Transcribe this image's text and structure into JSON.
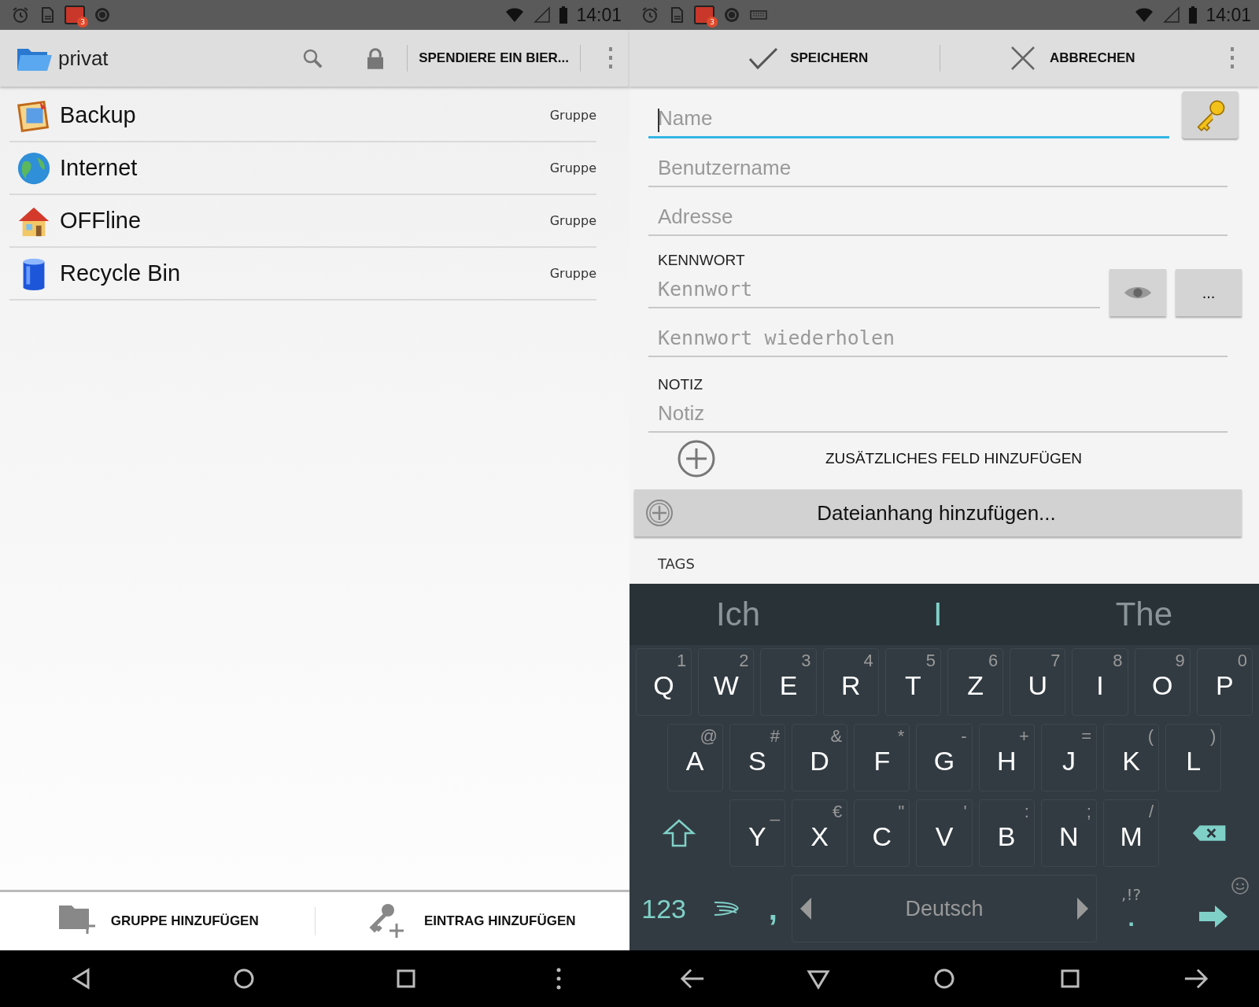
{
  "left": {
    "status": {
      "badge": "3",
      "time": "14:01"
    },
    "toolbar": {
      "title": "privat",
      "donate": "SPENDIERE EIN BIER..."
    },
    "groups": [
      {
        "name": "Backup",
        "type": "Gruppe"
      },
      {
        "name": "Internet",
        "type": "Gruppe"
      },
      {
        "name": "OFFline",
        "type": "Gruppe"
      },
      {
        "name": "Recycle Bin",
        "type": "Gruppe"
      }
    ],
    "bottom_actions": [
      {
        "label": "GRUPPE HINZUFÜGEN",
        "kind": "group"
      },
      {
        "label": "EINTRAG HINZUFÜGEN",
        "kind": "entry"
      }
    ]
  },
  "right": {
    "status": {
      "badge": "3",
      "time": "14:01"
    },
    "actions": [
      {
        "label": "SPEICHERN",
        "kind": "save"
      },
      {
        "label": "ABBRECHEN",
        "kind": "cancel"
      }
    ],
    "fields": [
      {
        "kind": "name",
        "placeholder": "Name",
        "focused": true
      },
      {
        "kind": "text",
        "placeholder": "Benutzername",
        "focused": false
      },
      {
        "kind": "text",
        "placeholder": "Adresse",
        "focused": false
      },
      {
        "kind": "password",
        "label": "KENNWORT",
        "placeholder": "Kennwort",
        "focused": false,
        "more": "..."
      },
      {
        "kind": "repeat",
        "placeholder": "Kennwort wiederholen",
        "focused": false
      },
      {
        "kind": "note",
        "label": "NOTIZ",
        "placeholder": "Notiz",
        "focused": false
      }
    ],
    "add_field": "ZUSÄTZLICHES FELD HINZUFÜGEN",
    "attachment": "Dateianhang hinzufügen...",
    "tags_label": "TAGS",
    "keyboard": {
      "suggestions": [
        {
          "text": "Ich",
          "selected": false
        },
        {
          "text": "I",
          "selected": true
        },
        {
          "text": "The",
          "selected": false
        }
      ],
      "rows": [
        {
          "keys": [
            {
              "kind": "char",
              "label": "Q",
              "hint": "1"
            },
            {
              "kind": "char",
              "label": "W",
              "hint": "2"
            },
            {
              "kind": "char",
              "label": "E",
              "hint": "3"
            },
            {
              "kind": "char",
              "label": "R",
              "hint": "4"
            },
            {
              "kind": "char",
              "label": "T",
              "hint": "5"
            },
            {
              "kind": "char",
              "label": "Z",
              "hint": "6"
            },
            {
              "kind": "char",
              "label": "U",
              "hint": "7"
            },
            {
              "kind": "char",
              "label": "I",
              "hint": "8"
            },
            {
              "kind": "char",
              "label": "O",
              "hint": "9"
            },
            {
              "kind": "char",
              "label": "P",
              "hint": "0"
            }
          ]
        },
        {
          "keys": [
            {
              "kind": "char",
              "label": "A",
              "hint": "@"
            },
            {
              "kind": "char",
              "label": "S",
              "hint": "#"
            },
            {
              "kind": "char",
              "label": "D",
              "hint": "&"
            },
            {
              "kind": "char",
              "label": "F",
              "hint": "*"
            },
            {
              "kind": "char",
              "label": "G",
              "hint": "-"
            },
            {
              "kind": "char",
              "label": "H",
              "hint": "+"
            },
            {
              "kind": "char",
              "label": "J",
              "hint": "="
            },
            {
              "kind": "char",
              "label": "K",
              "hint": "("
            },
            {
              "kind": "char",
              "label": "L",
              "hint": ")"
            }
          ]
        },
        {
          "keys": [
            {
              "kind": "shift"
            },
            {
              "kind": "char",
              "label": "Y",
              "hint": "_"
            },
            {
              "kind": "char",
              "label": "X",
              "hint": "€"
            },
            {
              "kind": "char",
              "label": "C",
              "hint": "\""
            },
            {
              "kind": "char",
              "label": "V",
              "hint": "'"
            },
            {
              "kind": "char",
              "label": "B",
              "hint": ":"
            },
            {
              "kind": "char",
              "label": "N",
              "hint": ";"
            },
            {
              "kind": "char",
              "label": "M",
              "hint": "/"
            },
            {
              "kind": "backspace"
            }
          ]
        },
        {
          "keys": [
            {
              "kind": "num",
              "label": "123"
            },
            {
              "kind": "swype"
            },
            {
              "kind": "comma",
              "label": ","
            },
            {
              "kind": "space",
              "label": "Deutsch"
            },
            {
              "kind": "period",
              "label": ".",
              "hint": ",!?"
            },
            {
              "kind": "enter"
            }
          ]
        }
      ]
    }
  }
}
